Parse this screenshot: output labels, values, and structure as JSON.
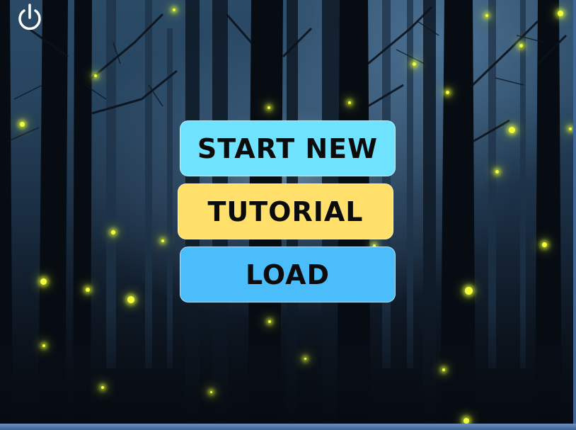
{
  "app": {
    "power_icon": "power-icon"
  },
  "menu": {
    "start_new_label": "START NEW",
    "tutorial_label": "TUTORIAL",
    "load_label": "LOAD"
  },
  "colors": {
    "start_new": "#6fe2ff",
    "tutorial": "#ffe06b",
    "load": "#4bbdfb",
    "firefly": "#f4ff3a"
  }
}
